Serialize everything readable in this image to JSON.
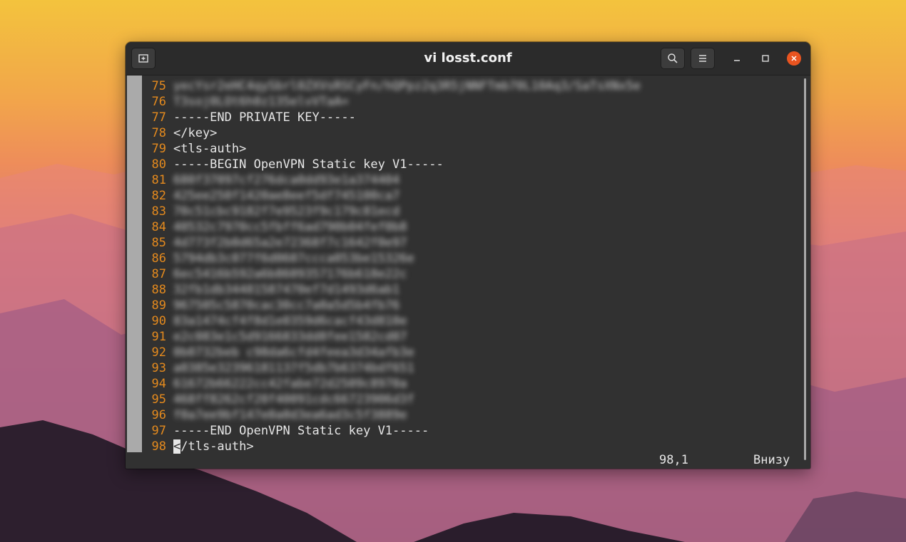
{
  "window": {
    "title": "vi losst.conf",
    "icons": {
      "new_tab": "new-tab-icon",
      "search": "search-icon",
      "menu": "hamburger-menu-icon",
      "minimize": "minimize-icon",
      "maximize": "maximize-icon",
      "close": "close-icon"
    },
    "accent": "#e95420"
  },
  "editor": {
    "lines": [
      {
        "num": "75",
        "text": "yecYsr2eHC4qySbrl0ZXVsRSCyFn/hQPpz2q3R5jNNFTmb70L10Aq3/SaTsXNx5e",
        "blurred": true
      },
      {
        "num": "76",
        "text": "T3soj0LOt6h0z135elvVTaA=",
        "blurred": true
      },
      {
        "num": "77",
        "text": "-----END PRIVATE KEY-----",
        "blurred": false
      },
      {
        "num": "78",
        "text": "</key>",
        "blurred": false
      },
      {
        "num": "79",
        "text": "<tls-auth>",
        "blurred": false
      },
      {
        "num": "80",
        "text": "-----BEGIN OpenVPN Static key V1-----",
        "blurred": false
      },
      {
        "num": "81",
        "text": "680f37097cf276dca0dd93e1a374404",
        "blurred": true
      },
      {
        "num": "82",
        "text": "425ee250f1420ae8eef5df745100ca7",
        "blurred": true
      },
      {
        "num": "83",
        "text": "70c51cbc9182f7e9523f9c179c81ecd",
        "blurred": true
      },
      {
        "num": "84",
        "text": "40532c7970cc5fbff6ad790b04fef0b8",
        "blurred": true
      },
      {
        "num": "85",
        "text": "4d773f2b0d65a2e72368f7c1642f0e97",
        "blurred": true
      },
      {
        "num": "86",
        "text": "5794db3c077f6d0607ccca053be15326e",
        "blurred": true
      },
      {
        "num": "87",
        "text": "6ec5416b592a6b8609357176b618e22c",
        "blurred": true
      },
      {
        "num": "88",
        "text": "32fb1db34481587470ef7d1493d6ab1",
        "blurred": true
      },
      {
        "num": "89",
        "text": "967505c5870cac30cc7a0a5d5b4fb76",
        "blurred": true
      },
      {
        "num": "90",
        "text": "83a1474cf4f8d1e0359d6cacf43d810e",
        "blurred": true
      },
      {
        "num": "91",
        "text": "e2c083e1c5d9166833dd8fee1582cd07",
        "blurred": true
      },
      {
        "num": "92",
        "text": "0b0732beb c98da6cfd4feea3d34afb3e",
        "blurred": true
      },
      {
        "num": "93",
        "text": "a0385e32396181137f5db7b6374bdf651",
        "blurred": true
      },
      {
        "num": "94",
        "text": "61672b66222cc42fabe72d2509c8970a",
        "blurred": true
      },
      {
        "num": "95",
        "text": "468ff8262cf20f40091cdc66723906d3f",
        "blurred": true
      },
      {
        "num": "96",
        "text": "f0a7ee9bf147e0a0d3ea6ad3c5f3889e",
        "blurred": true
      },
      {
        "num": "97",
        "text": "-----END OpenVPN Static key V1-----",
        "blurred": false
      },
      {
        "num": "98",
        "text": "</tls-auth>",
        "blurred": false,
        "cursor": true
      }
    ]
  },
  "status": {
    "position": "98,1",
    "location": "Внизу"
  }
}
